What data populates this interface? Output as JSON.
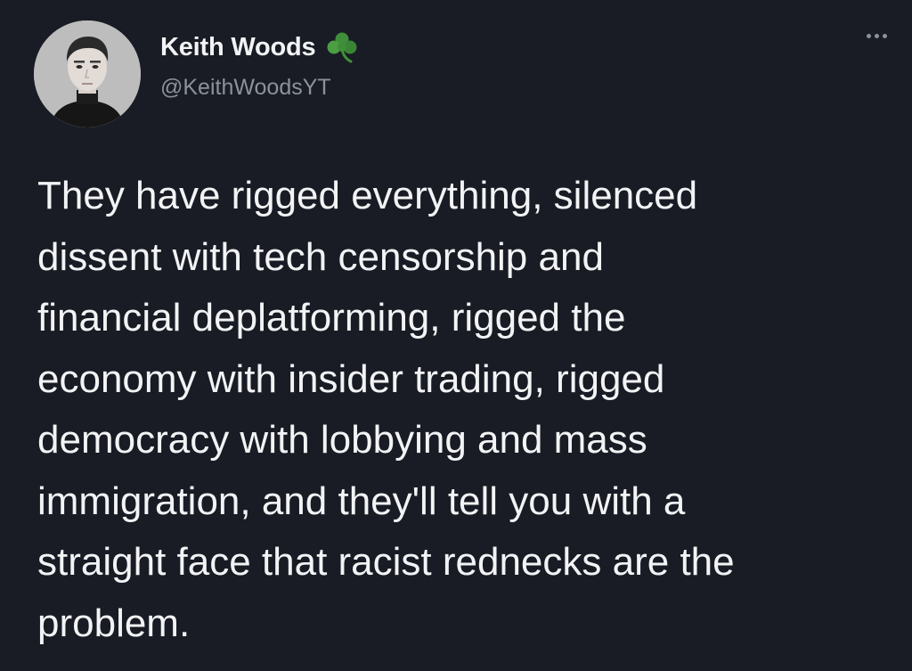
{
  "author": {
    "display_name": "Keith Woods",
    "handle": "@KeithWoodsYT",
    "badge_icon": "shamrock-icon",
    "badge_color": "#3f8f3a"
  },
  "tweet": {
    "text": "They have rigged everything, silenced\ndissent with tech censorship and\nfinancial deplatforming, rigged the\neconomy with insider trading, rigged\ndemocracy with lobbying and mass\nimmigration, and they'll tell you with a\nstraight face that racist rednecks are the\nproblem."
  },
  "menu": {
    "icon": "more-options-icon"
  },
  "theme": {
    "background": "#191c24",
    "text": "#f2f3f5",
    "secondary_text": "#8b9299"
  }
}
